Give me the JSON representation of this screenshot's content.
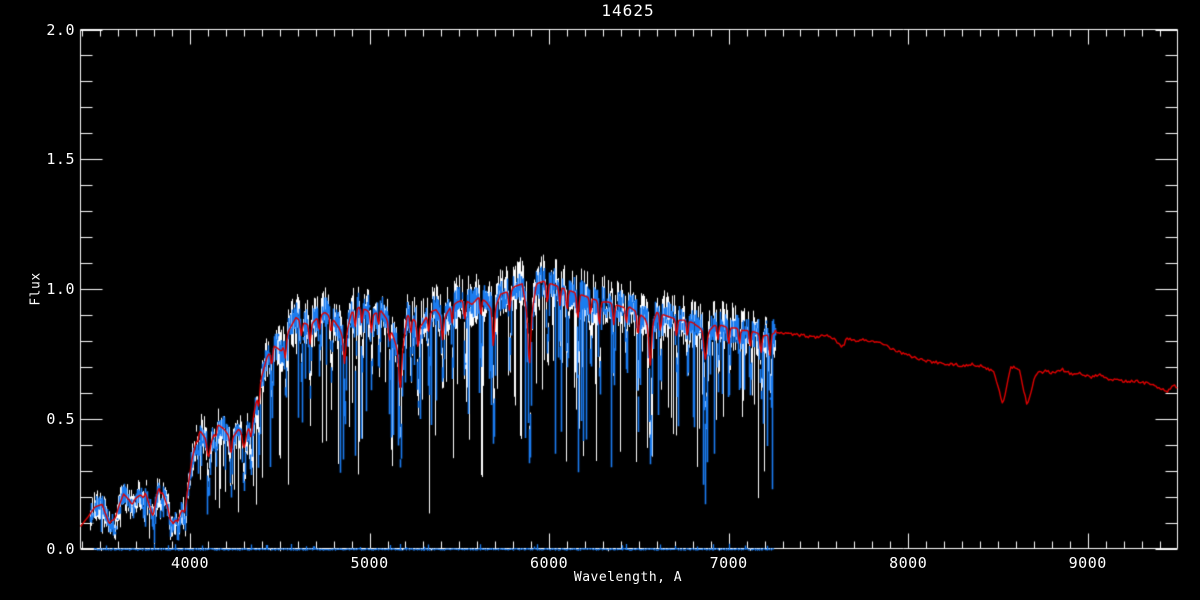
{
  "chart_data": {
    "type": "line",
    "title": "14625",
    "xlabel": "Wavelength, A",
    "ylabel": "Flux",
    "xlim": [
      3390,
      9500
    ],
    "ylim": [
      0.0,
      2.0
    ],
    "grid": false,
    "legend": "none",
    "x_ticks": {
      "values": [
        4000,
        5000,
        6000,
        7000,
        8000,
        9000
      ],
      "labels": [
        "4000",
        "5000",
        "6000",
        "7000",
        "8000",
        "9000"
      ],
      "minor_step": 100
    },
    "y_ticks": {
      "values": [
        0.0,
        0.5,
        1.0,
        1.5,
        2.0
      ],
      "labels": [
        "0.0",
        "0.5",
        "1.0",
        "1.5",
        "2.0"
      ],
      "minor_step": 0.1
    },
    "colors": {
      "background": "#000000",
      "axis": "#ffffff",
      "observed_raw": "#ffffff",
      "observed_overlay": "#1b7cf0",
      "template_fit": "#dd0000",
      "error_spectrum": "#1b7cf0"
    },
    "series": [
      {
        "name": "observed-spectrum-raw",
        "color": "#ffffff",
        "style": "noisy",
        "x_range": [
          3440,
          7260
        ],
        "noise_amp": [
          0.055,
          0.05
        ]
      },
      {
        "name": "observed-spectrum-overlay",
        "color": "#1b7cf0",
        "style": "noisy",
        "x_range": [
          3440,
          7260
        ],
        "noise_amp": [
          0.035,
          0.03
        ]
      },
      {
        "name": "template-fit",
        "color": "#dd0000",
        "style": "smooth",
        "x_range": [
          3390,
          9499
        ]
      },
      {
        "name": "error-spectrum",
        "color": "#1b7cf0",
        "style": "flat",
        "x_range": [
          3460,
          7250
        ],
        "flux_level": 0.005
      }
    ],
    "continuum": [
      [
        3390,
        0.085
      ],
      [
        3430,
        0.12
      ],
      [
        3470,
        0.16
      ],
      [
        3510,
        0.17
      ],
      [
        3550,
        0.095
      ],
      [
        3590,
        0.14
      ],
      [
        3630,
        0.21
      ],
      [
        3670,
        0.18
      ],
      [
        3710,
        0.2
      ],
      [
        3750,
        0.22
      ],
      [
        3790,
        0.13
      ],
      [
        3830,
        0.25
      ],
      [
        3870,
        0.17
      ],
      [
        3905,
        0.095
      ],
      [
        3940,
        0.13
      ],
      [
        3975,
        0.17
      ],
      [
        4010,
        0.34
      ],
      [
        4050,
        0.46
      ],
      [
        4090,
        0.42
      ],
      [
        4110,
        0.39
      ],
      [
        4150,
        0.48
      ],
      [
        4190,
        0.46
      ],
      [
        4230,
        0.42
      ],
      [
        4270,
        0.46
      ],
      [
        4310,
        0.44
      ],
      [
        4350,
        0.5
      ],
      [
        4390,
        0.64
      ],
      [
        4430,
        0.74
      ],
      [
        4470,
        0.78
      ],
      [
        4510,
        0.76
      ],
      [
        4550,
        0.84
      ],
      [
        4590,
        0.89
      ],
      [
        4630,
        0.87
      ],
      [
        4670,
        0.86
      ],
      [
        4710,
        0.89
      ],
      [
        4750,
        0.91
      ],
      [
        4790,
        0.89
      ],
      [
        4830,
        0.85
      ],
      [
        4861,
        0.8
      ],
      [
        4900,
        0.91
      ],
      [
        4940,
        0.93
      ],
      [
        4980,
        0.92
      ],
      [
        5020,
        0.9
      ],
      [
        5060,
        0.92
      ],
      [
        5100,
        0.88
      ],
      [
        5140,
        0.8
      ],
      [
        5175,
        0.72
      ],
      [
        5210,
        0.9
      ],
      [
        5250,
        0.88
      ],
      [
        5290,
        0.86
      ],
      [
        5330,
        0.91
      ],
      [
        5370,
        0.92
      ],
      [
        5410,
        0.88
      ],
      [
        5450,
        0.93
      ],
      [
        5490,
        0.95
      ],
      [
        5530,
        0.96
      ],
      [
        5570,
        0.94
      ],
      [
        5610,
        0.97
      ],
      [
        5650,
        0.95
      ],
      [
        5690,
        0.91
      ],
      [
        5730,
        0.98
      ],
      [
        5770,
        0.99
      ],
      [
        5810,
        1.01
      ],
      [
        5850,
        1.02
      ],
      [
        5890,
        0.85
      ],
      [
        5930,
        1.02
      ],
      [
        5970,
        1.03
      ],
      [
        6010,
        1.02
      ],
      [
        6050,
        1.01
      ],
      [
        6090,
        1.0
      ],
      [
        6130,
        0.99
      ],
      [
        6170,
        0.98
      ],
      [
        6210,
        0.97
      ],
      [
        6250,
        0.96
      ],
      [
        6290,
        0.95
      ],
      [
        6330,
        0.95
      ],
      [
        6370,
        0.94
      ],
      [
        6410,
        0.93
      ],
      [
        6450,
        0.93
      ],
      [
        6490,
        0.91
      ],
      [
        6530,
        0.89
      ],
      [
        6563,
        0.84
      ],
      [
        6600,
        0.91
      ],
      [
        6640,
        0.9
      ],
      [
        6680,
        0.89
      ],
      [
        6720,
        0.88
      ],
      [
        6760,
        0.88
      ],
      [
        6800,
        0.87
      ],
      [
        6840,
        0.85
      ],
      [
        6880,
        0.83
      ],
      [
        6920,
        0.86
      ],
      [
        6960,
        0.86
      ],
      [
        7000,
        0.85
      ],
      [
        7040,
        0.85
      ],
      [
        7080,
        0.84
      ],
      [
        7120,
        0.84
      ],
      [
        7160,
        0.83
      ],
      [
        7200,
        0.82
      ],
      [
        7255,
        0.83
      ]
    ],
    "template_tail": [
      [
        7255,
        0.84
      ],
      [
        7300,
        0.83
      ],
      [
        7360,
        0.825
      ],
      [
        7420,
        0.82
      ],
      [
        7480,
        0.815
      ],
      [
        7540,
        0.825
      ],
      [
        7600,
        0.8
      ],
      [
        7630,
        0.77
      ],
      [
        7660,
        0.81
      ],
      [
        7700,
        0.8
      ],
      [
        7760,
        0.805
      ],
      [
        7820,
        0.795
      ],
      [
        7880,
        0.78
      ],
      [
        7940,
        0.76
      ],
      [
        8000,
        0.745
      ],
      [
        8060,
        0.73
      ],
      [
        8120,
        0.72
      ],
      [
        8180,
        0.715
      ],
      [
        8240,
        0.71
      ],
      [
        8300,
        0.705
      ],
      [
        8360,
        0.71
      ],
      [
        8420,
        0.7
      ],
      [
        8480,
        0.68
      ],
      [
        8528,
        0.555
      ],
      [
        8570,
        0.7
      ],
      [
        8620,
        0.69
      ],
      [
        8662,
        0.55
      ],
      [
        8710,
        0.67
      ],
      [
        8760,
        0.685
      ],
      [
        8810,
        0.675
      ],
      [
        8860,
        0.69
      ],
      [
        8910,
        0.67
      ],
      [
        8960,
        0.675
      ],
      [
        9010,
        0.66
      ],
      [
        9060,
        0.67
      ],
      [
        9110,
        0.655
      ],
      [
        9160,
        0.65
      ],
      [
        9210,
        0.645
      ],
      [
        9260,
        0.645
      ],
      [
        9310,
        0.64
      ],
      [
        9360,
        0.63
      ],
      [
        9410,
        0.615
      ],
      [
        9440,
        0.6
      ],
      [
        9470,
        0.63
      ],
      [
        9499,
        0.62
      ]
    ],
    "absorption_lines": [
      [
        3580,
        0.4,
        14
      ],
      [
        3680,
        0.25,
        10
      ],
      [
        3740,
        0.3,
        10
      ],
      [
        3798,
        0.35,
        8
      ],
      [
        3835,
        0.4,
        8
      ],
      [
        3890,
        0.45,
        8
      ],
      [
        3933,
        0.55,
        8
      ],
      [
        3969,
        0.5,
        8
      ],
      [
        4045,
        0.25,
        7
      ],
      [
        4101,
        0.45,
        9
      ],
      [
        4144,
        0.28,
        7
      ],
      [
        4227,
        0.5,
        7
      ],
      [
        4300,
        0.45,
        11
      ],
      [
        4340,
        0.4,
        8
      ],
      [
        4383,
        0.4,
        7
      ],
      [
        4455,
        0.28,
        7
      ],
      [
        4531,
        0.3,
        7
      ],
      [
        4620,
        0.22,
        7
      ],
      [
        4668,
        0.3,
        7
      ],
      [
        4720,
        0.22,
        7
      ],
      [
        4785,
        0.25,
        7
      ],
      [
        4861,
        0.4,
        8
      ],
      [
        4920,
        0.25,
        7
      ],
      [
        4957,
        0.22,
        6
      ],
      [
        5010,
        0.28,
        7
      ],
      [
        5050,
        0.22,
        6
      ],
      [
        5110,
        0.25,
        7
      ],
      [
        5170,
        0.55,
        9
      ],
      [
        5230,
        0.25,
        6
      ],
      [
        5270,
        0.4,
        8
      ],
      [
        5330,
        0.3,
        7
      ],
      [
        5406,
        0.32,
        7
      ],
      [
        5460,
        0.25,
        6
      ],
      [
        5530,
        0.3,
        7
      ],
      [
        5620,
        0.25,
        6
      ],
      [
        5690,
        0.55,
        7
      ],
      [
        5780,
        0.3,
        7
      ],
      [
        5890,
        0.62,
        9
      ],
      [
        5990,
        0.28,
        7
      ],
      [
        6060,
        0.25,
        6
      ],
      [
        6100,
        0.28,
        7
      ],
      [
        6160,
        0.35,
        8
      ],
      [
        6230,
        0.25,
        6
      ],
      [
        6280,
        0.35,
        7
      ],
      [
        6360,
        0.3,
        7
      ],
      [
        6430,
        0.25,
        6
      ],
      [
        6495,
        0.35,
        7
      ],
      [
        6563,
        0.58,
        9
      ],
      [
        6620,
        0.28,
        6
      ],
      [
        6710,
        0.28,
        6
      ],
      [
        6770,
        0.25,
        6
      ],
      [
        6870,
        0.45,
        11
      ],
      [
        6940,
        0.25,
        6
      ],
      [
        7000,
        0.28,
        6
      ],
      [
        7060,
        0.25,
        6
      ],
      [
        7120,
        0.28,
        6
      ],
      [
        7180,
        0.32,
        7
      ],
      [
        7230,
        0.35,
        7
      ]
    ]
  }
}
